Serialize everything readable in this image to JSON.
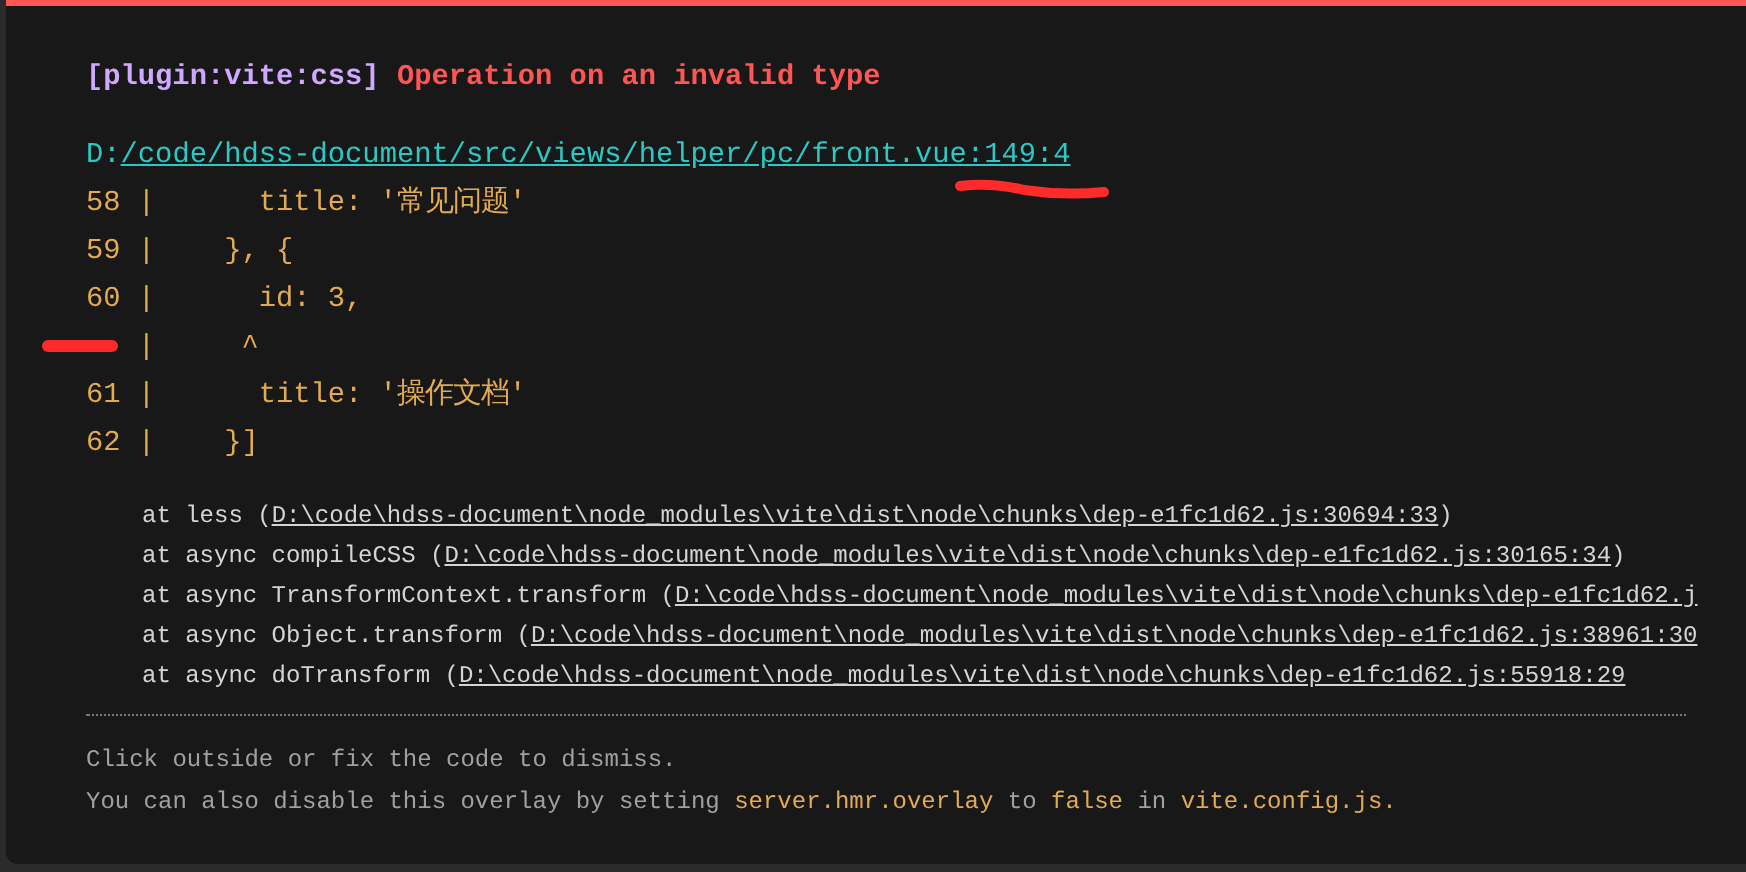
{
  "plugin": "[plugin:vite:css]",
  "message": "Operation on an invalid type",
  "file": {
    "drive": "D:",
    "path": "/code/hdss-document/src/views/helper/pc/front.vue:149:4"
  },
  "code_frame": [
    "58 |      title: '常见问题'",
    "59 |    }, {",
    "60 |      id: 3,",
    "   |     ^",
    "61 |      title: '操作文档'",
    "62 |    }]"
  ],
  "stack": [
    {
      "prefix": "at less (",
      "link": "D:\\code\\hdss-document\\node_modules\\vite\\dist\\node\\chunks\\dep-e1fc1d62.js:30694:33",
      "suffix": ")"
    },
    {
      "prefix": "at async compileCSS (",
      "link": "D:\\code\\hdss-document\\node_modules\\vite\\dist\\node\\chunks\\dep-e1fc1d62.js:30165:34",
      "suffix": ")"
    },
    {
      "prefix": "at async TransformContext.transform (",
      "link": "D:\\code\\hdss-document\\node_modules\\vite\\dist\\node\\chunks\\dep-e1fc1d62.j"
    },
    {
      "prefix": "at async Object.transform (",
      "link": "D:\\code\\hdss-document\\node_modules\\vite\\dist\\node\\chunks\\dep-e1fc1d62.js:38961:30"
    },
    {
      "prefix": "at async doTransform (",
      "link": "D:\\code\\hdss-document\\node_modules\\vite\\dist\\node\\chunks\\dep-e1fc1d62.js:55918:29"
    }
  ],
  "tip": "Click outside or fix the code to dismiss.",
  "tip2": [
    {
      "kind": "plain",
      "text": "You can also disable this overlay by setting "
    },
    {
      "kind": "code",
      "text": "server.hmr.overlay"
    },
    {
      "kind": "plain",
      "text": " to "
    },
    {
      "kind": "code",
      "text": "false"
    },
    {
      "kind": "plain",
      "text": " in "
    },
    {
      "kind": "code",
      "text": "vite.config.js."
    }
  ]
}
